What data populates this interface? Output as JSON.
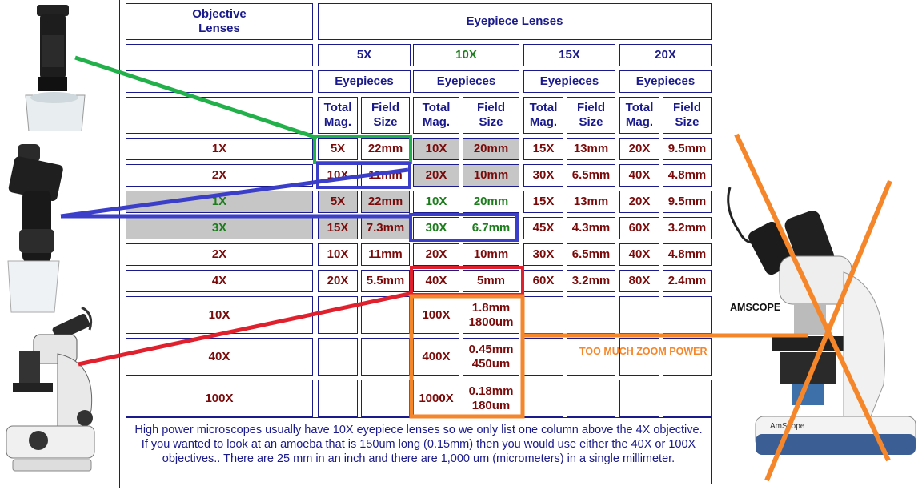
{
  "header": {
    "objective": [
      "Objective",
      "Lenses"
    ],
    "eyepiece": "Eyepiece Lenses",
    "powers": [
      "5X",
      "10X",
      "15X",
      "20X"
    ],
    "eyepieces_label": "Eyepieces",
    "total_mag": [
      "Total",
      "Mag."
    ],
    "field_size": [
      "Field",
      "Size"
    ]
  },
  "rows": [
    {
      "objective": "1X",
      "cells": [
        "5X",
        "22mm",
        "10X",
        "20mm",
        "15X",
        "13mm",
        "20X",
        "9.5mm"
      ]
    },
    {
      "objective": "2X",
      "cells": [
        "10X",
        "11mm",
        "20X",
        "10mm",
        "30X",
        "6.5mm",
        "40X",
        "4.8mm"
      ]
    },
    {
      "objective": "1X",
      "cells": [
        "5X",
        "22mm",
        "10X",
        "20mm",
        "15X",
        "13mm",
        "20X",
        "9.5mm"
      ]
    },
    {
      "objective": "3X",
      "cells": [
        "15X",
        "7.3mm",
        "30X",
        "6.7mm",
        "45X",
        "4.3mm",
        "60X",
        "3.2mm"
      ]
    },
    {
      "objective": "2X",
      "cells": [
        "10X",
        "11mm",
        "20X",
        "10mm",
        "30X",
        "6.5mm",
        "40X",
        "4.8mm"
      ]
    },
    {
      "objective": "4X",
      "cells": [
        "20X",
        "5.5mm",
        "40X",
        "5mm",
        "60X",
        "3.2mm",
        "80X",
        "2.4mm"
      ]
    },
    {
      "objective": "10X",
      "cells": [
        "",
        "",
        "100X",
        [
          "1.8mm",
          "1800um"
        ],
        "",
        "",
        "",
        ""
      ]
    },
    {
      "objective": "40X",
      "cells": [
        "",
        "",
        "400X",
        [
          "0.45mm",
          "450um"
        ],
        "",
        "",
        "",
        ""
      ]
    },
    {
      "objective": "100X",
      "cells": [
        "",
        "",
        "1000X",
        [
          "0.18mm",
          "180um"
        ],
        "",
        "",
        "",
        ""
      ]
    }
  ],
  "note": "High power microscopes usually have 10X eyepiece lenses so we only list one column above the 4X objective.  If you wanted to look at an amoeba that is 150um long (0.15mm) then you would use either the 40X or 100X objectives..  There are 25 mm in an inch and there are 1,000 um (micrometers) in a single millimeter.",
  "labels": {
    "amscope": "AMSCOPE",
    "too_much": "TOO MUCH ZOOM POWER"
  },
  "colors": {
    "navy": "#1a1a8c",
    "dark_red": "#7a0a0a",
    "green_text": "#1b7d1b",
    "grey_fill": "#c6c6c6",
    "green_line": "#22b04a",
    "blue_line": "#3a3ec8",
    "red_line": "#e0202c",
    "orange_line": "#f5862a"
  },
  "images": [
    "handheld-microscope-icon",
    "pocket-microscope-icon",
    "student-microscope-icon",
    "amscope-microscope-icon"
  ]
}
